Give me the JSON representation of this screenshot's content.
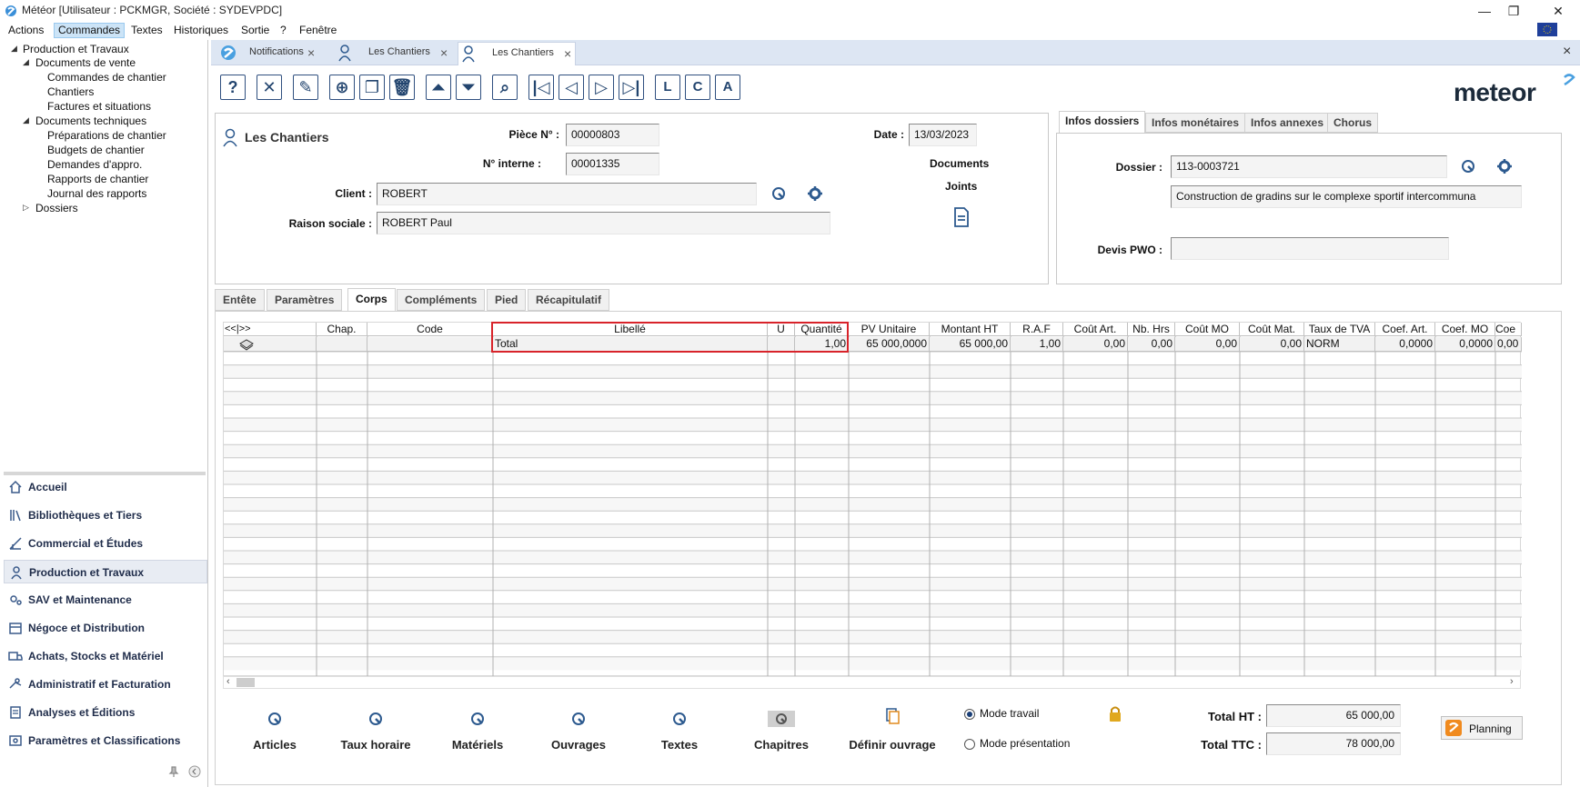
{
  "window": {
    "title": "Météor [Utilisateur : PCKMGR, Société : SYDEVPDC]",
    "minimize": "—",
    "maximize": "❐",
    "close": "✕"
  },
  "menu": [
    "Actions",
    "Commandes",
    "Textes",
    "Historiques",
    "Sortie",
    "?",
    "Fenêtre"
  ],
  "menu_selected": "Commandes",
  "tree": {
    "root": "Production et Travaux",
    "docs_vente": "Documents de vente",
    "cmd_chantier": "Commandes de chantier",
    "chantiers": "Chantiers",
    "factures": "Factures et situations",
    "docs_tech": "Documents techniques",
    "prep": "Préparations de chantier",
    "budgets": "Budgets de chantier",
    "demandes": "Demandes d'appro.",
    "rapports": "Rapports de chantier",
    "journal": "Journal des rapports",
    "dossiers": "Dossiers"
  },
  "modules": [
    {
      "label": "Accueil",
      "icon": "home-icon"
    },
    {
      "label": "Bibliothèques et Tiers",
      "icon": "library-icon"
    },
    {
      "label": "Commercial et Études",
      "icon": "drafting-icon"
    },
    {
      "label": "Production et Travaux",
      "icon": "worker-icon"
    },
    {
      "label": "SAV et Maintenance",
      "icon": "gears-icon"
    },
    {
      "label": "Négoce et Distribution",
      "icon": "box-icon"
    },
    {
      "label": "Achats, Stocks et Matériel",
      "icon": "truck-icon"
    },
    {
      "label": "Administratif et Facturation",
      "icon": "money-icon"
    },
    {
      "label": "Analyses et Éditions",
      "icon": "report-icon"
    },
    {
      "label": "Paramètres et Classifications",
      "icon": "settings-icon"
    }
  ],
  "doc_tabs": [
    {
      "label": "Notifications"
    },
    {
      "label": "Les Chantiers"
    },
    {
      "label": "Les Chantiers"
    }
  ],
  "brand": {
    "logo": "meteor"
  },
  "header": {
    "title": "Les Chantiers",
    "piece_label": "Pièce N° :",
    "piece_value": "00000803",
    "interne_label": "N° interne :",
    "interne_value": "00001335",
    "date_label": "Date :",
    "date_value": "13/03/2023",
    "client_label": "Client :",
    "client_value": "ROBERT",
    "raison_label": "Raison sociale :",
    "raison_value": "ROBERT Paul",
    "docs_label1": "Documents",
    "docs_label2": "Joints"
  },
  "right_tabs": [
    "Infos dossiers",
    "Infos monétaires",
    "Infos annexes",
    "Chorus"
  ],
  "dossier": {
    "label": "Dossier :",
    "value": "113-0003721",
    "description": "Construction de gradins sur le complexe sportif intercommuna",
    "devis_label": "Devis PWO :",
    "devis_value": ""
  },
  "form_tabs": [
    "Entête",
    "Paramètres",
    "Corps",
    "Compléments",
    "Pied",
    "Récapitulatif"
  ],
  "form_tab_active": "Corps",
  "grid": {
    "nav": "<<|>>",
    "columns": [
      "Chap.",
      "Code",
      "Libellé",
      "U",
      "Quantité",
      "PV Unitaire",
      "Montant HT",
      "R.A.F",
      "Coût Art.",
      "Nb. Hrs",
      "Coût MO",
      "Coût Mat.",
      "Taux de TVA",
      "Coef. Art.",
      "Coef. MO",
      "Coe"
    ],
    "row": [
      "",
      "",
      "Total",
      "",
      "1,00",
      "65 000,0000",
      "65 000,00",
      "1,00",
      "0,00",
      "0,00",
      "0,00",
      "0,00",
      "NORM",
      "0,0000",
      "0,0000",
      "0,00"
    ]
  },
  "bottom_buttons": [
    "Articles",
    "Taux horaire",
    "Matériels",
    "Ouvrages",
    "Textes",
    "Chapitres",
    "Définir ouvrage"
  ],
  "modes": {
    "travail": "Mode travail",
    "presentation": "Mode présentation",
    "selected": "travail"
  },
  "totals": {
    "ht_label": "Total HT :",
    "ht_value": "65 000,00",
    "ttc_label": "Total TTC :",
    "ttc_value": "78 000,00"
  },
  "planning_label": "Planning",
  "colors": {
    "accent": "#2d5a8f",
    "highlight": "#d8232a",
    "tab_bg": "#dde6f3"
  }
}
